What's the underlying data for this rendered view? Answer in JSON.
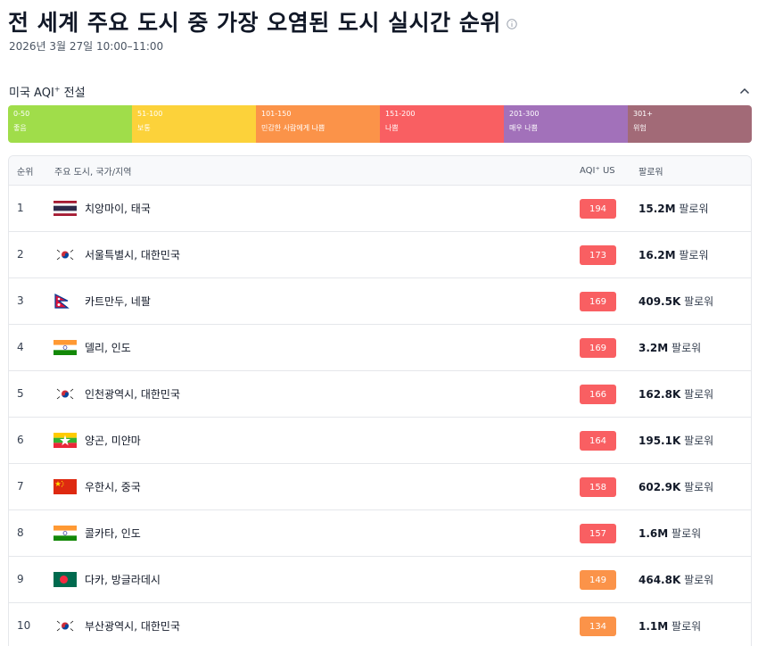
{
  "header": {
    "title": "전 세계 주요 도시 중 가장 오염된 도시 실시간 순위",
    "subtitle": "2026년 3월 27일 10:00–11:00"
  },
  "legend": {
    "title": "미국 AQI",
    "title_sup": "+",
    "title_suffix": " 전설",
    "segments": [
      {
        "range": "0-50",
        "label": "좋음",
        "color": "#a0dd4a"
      },
      {
        "range": "51-100",
        "label": "보통",
        "color": "#fcd23a"
      },
      {
        "range": "101-150",
        "label": "민감한 사람에게 나쁨",
        "color": "#fb9349"
      },
      {
        "range": "151-200",
        "label": "나쁨",
        "color": "#f95f62"
      },
      {
        "range": "201-300",
        "label": "매우 나쁨",
        "color": "#a271ba"
      },
      {
        "range": "301+",
        "label": "위험",
        "color": "#a26a77"
      }
    ]
  },
  "table": {
    "headers": {
      "rank": "순위",
      "city": "주요 도시, 국가/지역",
      "aqi": "AQI⁺ US",
      "followers": "팔로워"
    },
    "follower_suffix": "팔로워",
    "rows": [
      {
        "rank": "1",
        "city": "치앙마이, 태국",
        "flag": "thailand-flag",
        "aqi": "194",
        "aqi_color": "#f95f62",
        "followers": "15.2M"
      },
      {
        "rank": "2",
        "city": "서울특별시, 대한민국",
        "flag": "south-korea-flag",
        "aqi": "173",
        "aqi_color": "#f95f62",
        "followers": "16.2M"
      },
      {
        "rank": "3",
        "city": "카트만두, 네팔",
        "flag": "nepal-flag",
        "aqi": "169",
        "aqi_color": "#f95f62",
        "followers": "409.5K"
      },
      {
        "rank": "4",
        "city": "델리, 인도",
        "flag": "india-flag",
        "aqi": "169",
        "aqi_color": "#f95f62",
        "followers": "3.2M"
      },
      {
        "rank": "5",
        "city": "인천광역시, 대한민국",
        "flag": "south-korea-flag",
        "aqi": "166",
        "aqi_color": "#f95f62",
        "followers": "162.8K"
      },
      {
        "rank": "6",
        "city": "양곤, 미얀마",
        "flag": "myanmar-flag",
        "aqi": "164",
        "aqi_color": "#f95f62",
        "followers": "195.1K"
      },
      {
        "rank": "7",
        "city": "우한시, 중국",
        "flag": "china-flag",
        "aqi": "158",
        "aqi_color": "#f95f62",
        "followers": "602.9K"
      },
      {
        "rank": "8",
        "city": "콜카타, 인도",
        "flag": "india-flag",
        "aqi": "157",
        "aqi_color": "#f95f62",
        "followers": "1.6M"
      },
      {
        "rank": "9",
        "city": "다카, 방글라데시",
        "flag": "bangladesh-flag",
        "aqi": "149",
        "aqi_color": "#fb9349",
        "followers": "464.8K"
      },
      {
        "rank": "10",
        "city": "부산광역시, 대한민국",
        "flag": "south-korea-flag",
        "aqi": "134",
        "aqi_color": "#fb9349",
        "followers": "1.1M"
      }
    ]
  }
}
